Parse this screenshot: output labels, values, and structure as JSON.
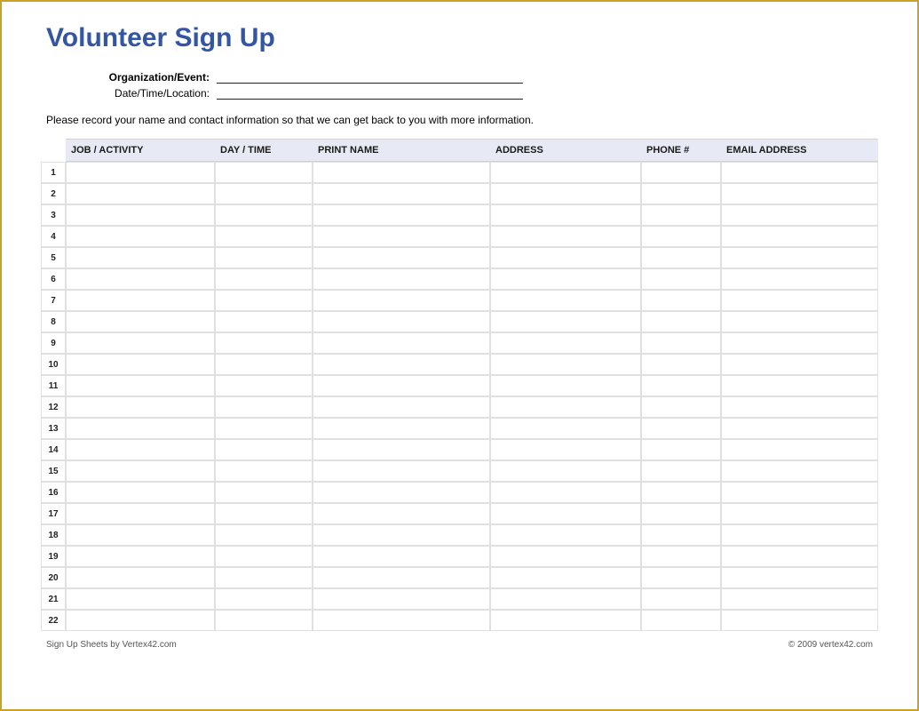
{
  "title": "Volunteer Sign Up",
  "meta": {
    "org_label": "Organization/Event:",
    "org_value": "",
    "dtl_label": "Date/Time/Location:",
    "dtl_value": ""
  },
  "instructions": "Please record your name and contact information so that we can get back to you with more information.",
  "columns": {
    "job": "JOB / ACTIVITY",
    "day": "DAY / TIME",
    "name": "PRINT NAME",
    "address": "ADDRESS",
    "phone": "PHONE #",
    "email": "EMAIL ADDRESS"
  },
  "rows": [
    {
      "n": "1",
      "job": "",
      "day": "",
      "name": "",
      "address": "",
      "phone": "",
      "email": ""
    },
    {
      "n": "2",
      "job": "",
      "day": "",
      "name": "",
      "address": "",
      "phone": "",
      "email": ""
    },
    {
      "n": "3",
      "job": "",
      "day": "",
      "name": "",
      "address": "",
      "phone": "",
      "email": ""
    },
    {
      "n": "4",
      "job": "",
      "day": "",
      "name": "",
      "address": "",
      "phone": "",
      "email": ""
    },
    {
      "n": "5",
      "job": "",
      "day": "",
      "name": "",
      "address": "",
      "phone": "",
      "email": ""
    },
    {
      "n": "6",
      "job": "",
      "day": "",
      "name": "",
      "address": "",
      "phone": "",
      "email": ""
    },
    {
      "n": "7",
      "job": "",
      "day": "",
      "name": "",
      "address": "",
      "phone": "",
      "email": ""
    },
    {
      "n": "8",
      "job": "",
      "day": "",
      "name": "",
      "address": "",
      "phone": "",
      "email": ""
    },
    {
      "n": "9",
      "job": "",
      "day": "",
      "name": "",
      "address": "",
      "phone": "",
      "email": ""
    },
    {
      "n": "10",
      "job": "",
      "day": "",
      "name": "",
      "address": "",
      "phone": "",
      "email": ""
    },
    {
      "n": "11",
      "job": "",
      "day": "",
      "name": "",
      "address": "",
      "phone": "",
      "email": ""
    },
    {
      "n": "12",
      "job": "",
      "day": "",
      "name": "",
      "address": "",
      "phone": "",
      "email": ""
    },
    {
      "n": "13",
      "job": "",
      "day": "",
      "name": "",
      "address": "",
      "phone": "",
      "email": ""
    },
    {
      "n": "14",
      "job": "",
      "day": "",
      "name": "",
      "address": "",
      "phone": "",
      "email": ""
    },
    {
      "n": "15",
      "job": "",
      "day": "",
      "name": "",
      "address": "",
      "phone": "",
      "email": ""
    },
    {
      "n": "16",
      "job": "",
      "day": "",
      "name": "",
      "address": "",
      "phone": "",
      "email": ""
    },
    {
      "n": "17",
      "job": "",
      "day": "",
      "name": "",
      "address": "",
      "phone": "",
      "email": ""
    },
    {
      "n": "18",
      "job": "",
      "day": "",
      "name": "",
      "address": "",
      "phone": "",
      "email": ""
    },
    {
      "n": "19",
      "job": "",
      "day": "",
      "name": "",
      "address": "",
      "phone": "",
      "email": ""
    },
    {
      "n": "20",
      "job": "",
      "day": "",
      "name": "",
      "address": "",
      "phone": "",
      "email": ""
    },
    {
      "n": "21",
      "job": "",
      "day": "",
      "name": "",
      "address": "",
      "phone": "",
      "email": ""
    },
    {
      "n": "22",
      "job": "",
      "day": "",
      "name": "",
      "address": "",
      "phone": "",
      "email": ""
    }
  ],
  "footer": {
    "left": "Sign Up Sheets by Vertex42.com",
    "right": "© 2009 vertex42.com"
  }
}
